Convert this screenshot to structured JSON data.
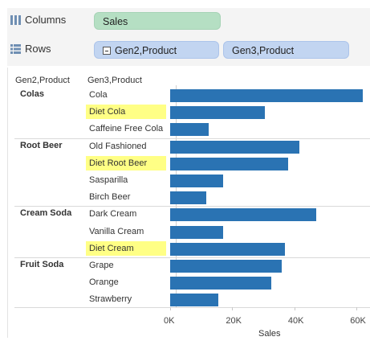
{
  "shelves": {
    "columns": {
      "label": "Columns",
      "icon": "columns-shelf-icon",
      "pills": [
        {
          "label": "Sales",
          "type": "measure"
        }
      ]
    },
    "rows": {
      "label": "Rows",
      "icon": "rows-shelf-icon",
      "pills": [
        {
          "label": "Gen2,Product",
          "collapse": true
        },
        {
          "label": "Gen3,Product"
        }
      ]
    }
  },
  "headers": {
    "col1": "Gen2,Product",
    "col2": "Gen3,Product"
  },
  "chart_data": {
    "type": "bar",
    "xlabel": "Sales",
    "xlim": [
      0,
      62000
    ],
    "ticks": [
      "0K",
      "20K",
      "40K",
      "60K"
    ],
    "groups": [
      {
        "name": "Colas",
        "items": [
          {
            "label": "Cola",
            "value": 62000,
            "highlight": false
          },
          {
            "label": "Diet Cola",
            "value": 30500,
            "highlight": true
          },
          {
            "label": "Caffeine Free Cola",
            "value": 12500,
            "highlight": false
          }
        ]
      },
      {
        "name": "Root Beer",
        "items": [
          {
            "label": "Old Fashioned",
            "value": 41500,
            "highlight": false
          },
          {
            "label": "Diet Root Beer",
            "value": 38000,
            "highlight": true
          },
          {
            "label": "Sasparilla",
            "value": 17000,
            "highlight": false
          },
          {
            "label": "Birch Beer",
            "value": 11500,
            "highlight": false
          }
        ]
      },
      {
        "name": "Cream Soda",
        "items": [
          {
            "label": "Dark Cream",
            "value": 47000,
            "highlight": false
          },
          {
            "label": "Vanilla Cream",
            "value": 17000,
            "highlight": false
          },
          {
            "label": "Diet Cream",
            "value": 37000,
            "highlight": true
          }
        ]
      },
      {
        "name": "Fruit Soda",
        "items": [
          {
            "label": "Grape",
            "value": 36000,
            "highlight": false
          },
          {
            "label": "Orange",
            "value": 32500,
            "highlight": false
          },
          {
            "label": "Strawberry",
            "value": 15500,
            "highlight": false
          }
        ]
      }
    ],
    "bar_color": "#2a73b3",
    "highlight_color": "#ffff85"
  }
}
